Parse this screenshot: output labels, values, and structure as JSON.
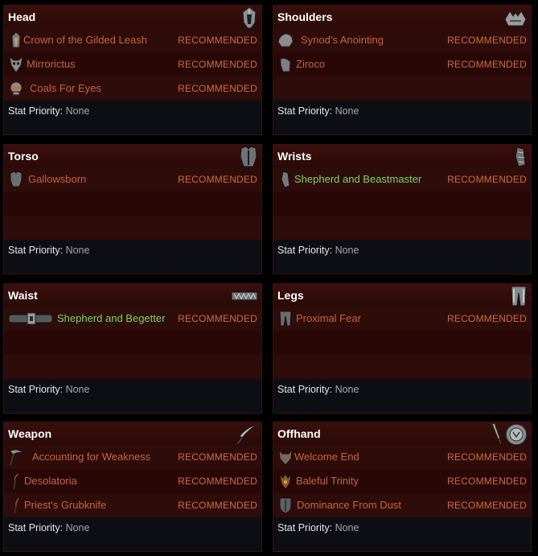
{
  "recommended_label": "RECOMMENDED",
  "stat_priority_label": "Stat Priority:",
  "stat_priority_value": "None",
  "colors": {
    "legendary": "#c8633a",
    "set": "#7bd65f",
    "recommended": "#d26a3a"
  },
  "panels": [
    {
      "title": "Head",
      "icon": "helmet-icon",
      "items": [
        {
          "name": "Crown of the Gilded Leash",
          "icon": "crown-icon",
          "rarity": "legendary"
        },
        {
          "name": "Mirrorictus",
          "icon": "mask-icon",
          "rarity": "legendary"
        },
        {
          "name": "Coals For Eyes",
          "icon": "skull-icon",
          "rarity": "legendary"
        }
      ]
    },
    {
      "title": "Shoulders",
      "icon": "shoulders-icon",
      "items": [
        {
          "name": "Synod's Anointing",
          "icon": "pauldron-icon",
          "rarity": "legendary"
        },
        {
          "name": "Ziroco",
          "icon": "pauldron-icon",
          "rarity": "legendary"
        }
      ]
    },
    {
      "title": "Torso",
      "icon": "chest-armor-icon",
      "items": [
        {
          "name": "Gallowsborn",
          "icon": "chest-armor-icon",
          "rarity": "legendary"
        }
      ]
    },
    {
      "title": "Wrists",
      "icon": "bracers-icon",
      "items": [
        {
          "name": "Shepherd and Beastmaster",
          "icon": "bracer-icon",
          "rarity": "set"
        }
      ]
    },
    {
      "title": "Waist",
      "icon": "belt-icon",
      "items": [
        {
          "name": "Shepherd and Begetter",
          "icon": "belt-icon",
          "rarity": "set"
        }
      ]
    },
    {
      "title": "Legs",
      "icon": "legs-icon",
      "items": [
        {
          "name": "Proximal Fear",
          "icon": "greaves-icon",
          "rarity": "legendary"
        }
      ]
    },
    {
      "title": "Weapon",
      "icon": "dagger-icon",
      "items": [
        {
          "name": "Accounting for Weakness",
          "icon": "scythe-icon",
          "rarity": "legendary"
        },
        {
          "name": "Desolatoria",
          "icon": "sickle-icon",
          "rarity": "legendary"
        },
        {
          "name": "Priest's Grubknife",
          "icon": "knife-icon",
          "rarity": "legendary"
        }
      ]
    },
    {
      "title": "Offhand",
      "icon": "offhand-icon",
      "items": [
        {
          "name": "Welcome End",
          "icon": "demon-mask-icon",
          "rarity": "legendary"
        },
        {
          "name": "Baleful Trinity",
          "icon": "idol-icon",
          "rarity": "legendary"
        },
        {
          "name": "Dominance From Dust",
          "icon": "shield-icon",
          "rarity": "legendary"
        }
      ]
    }
  ]
}
